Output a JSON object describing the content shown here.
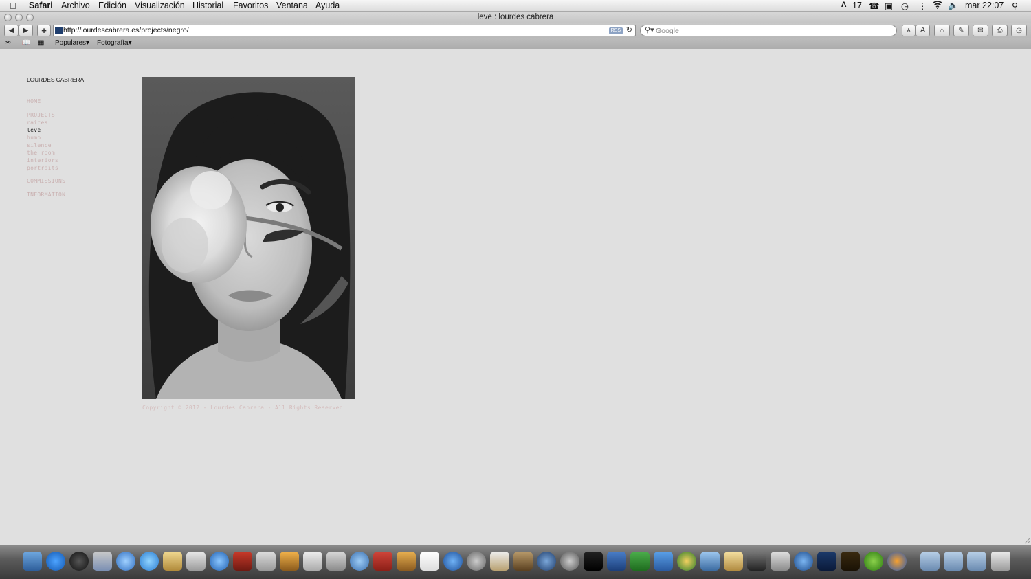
{
  "menubar": {
    "app_name": "Safari",
    "menus": [
      "Archivo",
      "Edición",
      "Visualización",
      "Historial",
      "Favoritos",
      "Ventana",
      "Ayuda"
    ],
    "status_number": "17",
    "clock": "mar 22:07"
  },
  "window": {
    "title": "leve : lourdes cabrera"
  },
  "toolbar": {
    "url": "http://lourdescabrera.es/projects/negro/",
    "rss_label": "RSS",
    "search_placeholder": "Google",
    "text_smaller": "A",
    "text_larger": "A"
  },
  "bookmarks": {
    "items": [
      "Populares",
      "Fotografía"
    ]
  },
  "site": {
    "title": "LOURDES CABRERA",
    "nav": {
      "home": "HOME",
      "projects": "PROJECTS",
      "items": [
        "raices",
        "leve",
        "humo",
        "silence",
        "the room",
        "interiors",
        "portraits"
      ],
      "active_index": 1,
      "commissions": "COMMISSIONS",
      "information": "INFORMATION"
    },
    "copyright": "Copyright © 2012 - Lourdes Cabrera - All Rights Reserved"
  },
  "colors": {
    "page_background": "#e0e0e0",
    "nav_link": "#c9b0b0",
    "nav_active": "#222222"
  }
}
